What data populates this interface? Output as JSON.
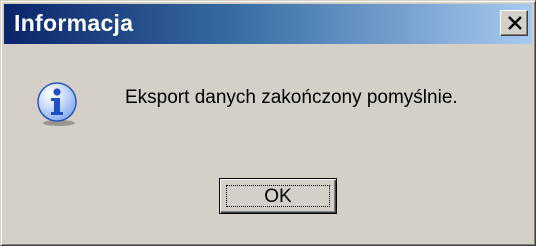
{
  "window": {
    "title": "Informacja",
    "close_icon": "close-icon"
  },
  "dialog": {
    "icon": "information-icon",
    "message": "Eksport danych zakończony pomyślnie.",
    "ok_label": "OK"
  },
  "colors": {
    "titlebar_start": "#0a246a",
    "titlebar_end": "#a6caf0",
    "face": "#d4d0c8",
    "icon_blue": "#1f5fd6"
  }
}
